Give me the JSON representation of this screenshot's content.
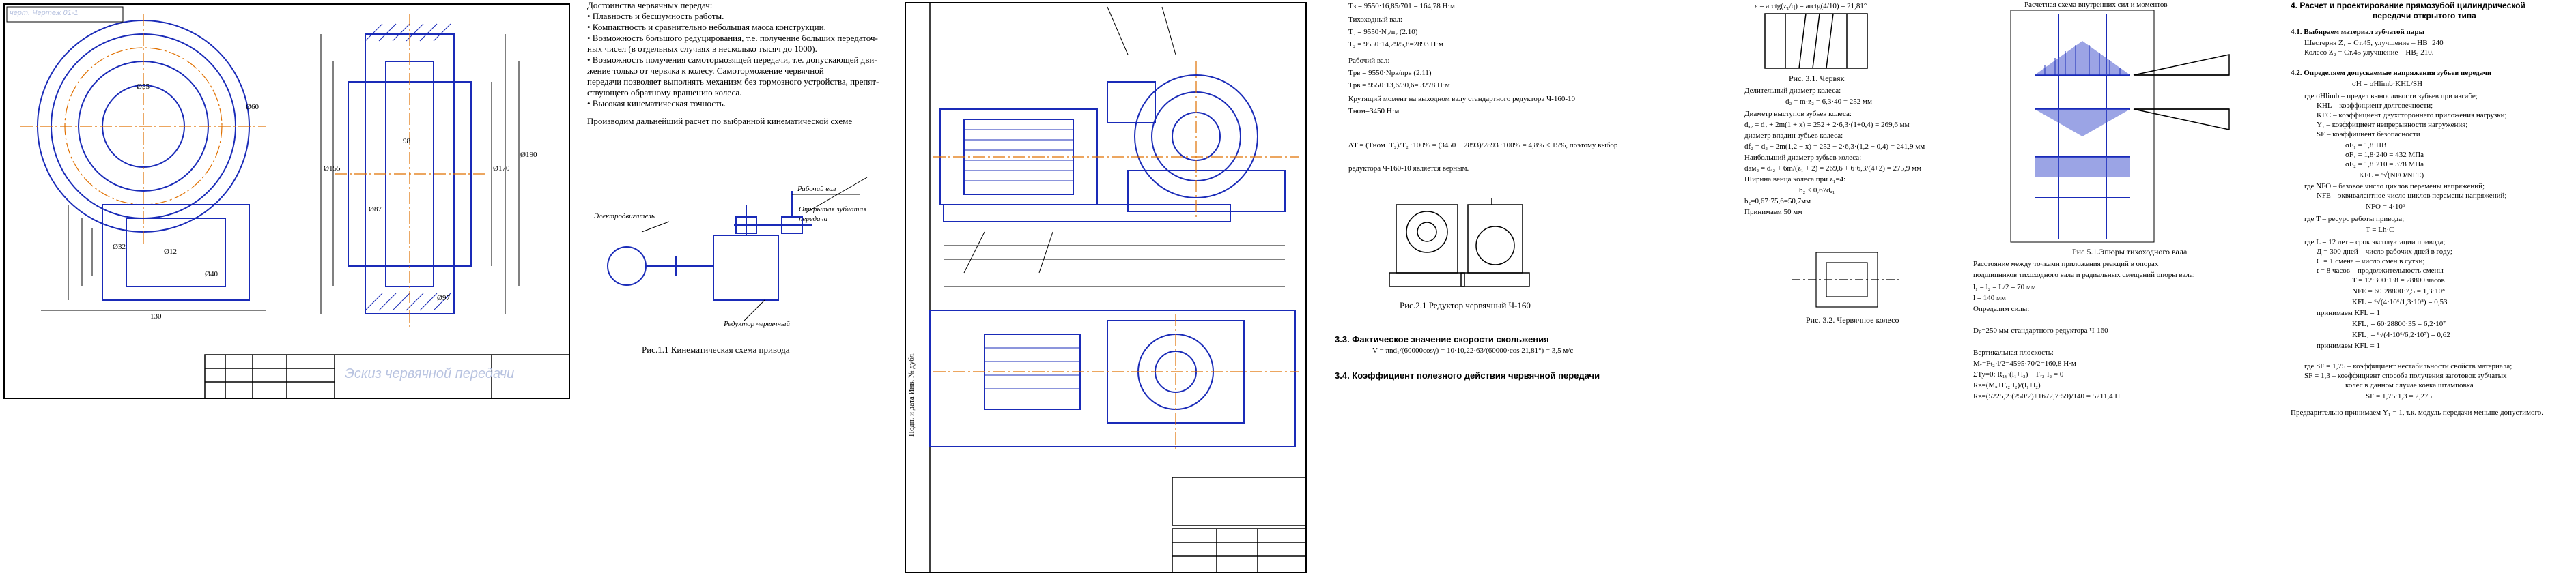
{
  "sheet1": {
    "corner_label": "черт. Чертеж  01-1",
    "title_block": "Эскиз червячной передачи",
    "dims": [
      "Ø55",
      "Ø60",
      "Ø32",
      "Ø12",
      "Ø40",
      "130",
      "Ø155",
      "Ø170",
      "Ø190",
      "98",
      "Ø87",
      "Ø97"
    ]
  },
  "sheet2": {
    "heading": "Достоинства червячных передач:",
    "bullets": [
      "• Плавность и бесшумность работы.",
      "• Компактность и сравнительно небольшая масса конструкции.",
      "• Возможность большого редуцирования, т.е. получение больших передаточ-",
      "  ных чисел (в отдельных случаях в несколько тысяч до 1000).",
      "• Возможность получения самотормозящей передачи, т.е. допускающей дви-",
      "  жение только от червяка к колесу. Самоторможение червячной",
      "  передачи позволяет выполнять механизм без тормозного устройства, препят-",
      "  ствующего обратному вращению колеса.",
      "• Высокая кинематическая точность."
    ],
    "paragraph": "Производим дальнейший расчет по выбранной кинематической схеме",
    "labels": [
      "Рабочий вал",
      "Открытая зубчатая",
      "передача",
      "Электродвигатель",
      "Редуктор червячный"
    ],
    "caption": "Рис.1.1 Кинематическая схема привода"
  },
  "sheet3": {
    "stamp": "Подп. и дата  Инв. № дубл."
  },
  "sheet4": {
    "lines": [
      "Тз = 9550·16,85/701 = 164,78 Н·м",
      "Тихоходный вал:",
      "Т₂ = 9550·N₂/n₂                                         (2.10)",
      "Т₂ = 9550·14,29/5,8=2893 Н·м",
      "Рабочий вал:",
      "Tрв = 9550·Nрв/nрв                                     (2.11)",
      "Tрв = 9550·13,6/30,6= 3278 Н·м",
      "Крутящий момент на выходном валу стандартного редуктора Ч-160-10",
      "Tном=3450 Н·м",
      "ΔT = (Tном−T₂)/T₂ ·100% = (3450 − 2893)/2893 ·100% = 4,8% < 15%, поэтому выбор",
      "редуктора Ч-160-10 является верным."
    ],
    "caption": "Рис.2.1 Редуктор червячный Ч-160",
    "section_33": "3.3.   Фактическое значение скорости скольжения",
    "line_33": "V = πnd₁/(60000cosγ) = 10·10,22·63/(60000·cos 21,81°) = 3,5 м/с",
    "section_34": "3.4.   Коэффициент полезного действия червячной передачи"
  },
  "sheet5": {
    "top": "ε = arctg(z₁/q) = arctg(4/10) = 21,81°",
    "caption_a": "Рис. 3.1. Червяк",
    "lines": [
      "Делительный диаметр колеса:",
      "d₂ = m·z₂ = 6,3·40 = 252 мм",
      "Диаметр выступов зубьев колеса:",
      "dₐ₂ = d₂ + 2m(1 + x) = 252 + 2·6,3·(1+0,4) = 269,6 мм",
      "диаметр впадин зубьев колеса:",
      "df₂ = d₂ − 2m(1,2 − x) = 252 − 2·6,3·(1,2 − 0,4) = 241,9 мм",
      "Наибольший диаметр зубьев колеса:",
      "daм₂ = dₐ₂ + 6m/(z₁ + 2) = 269,6 + 6·6,3/(4+2) = 275,9 мм",
      "Ширина венца колеса при z₁=4:",
      "b₂ ≤ 0,67dₐ₁",
      "b₂=0,67·75,6=50,7мм",
      "Принимаем 50 мм"
    ],
    "caption_b": "Рис. 3.2. Червячное колесо"
  },
  "sheet6": {
    "top": "Расчетная схема внутренних сил и моментов",
    "caption": "Рис 5.1.Эпюры тихоходного вала",
    "lines": [
      "Расстояние между точками приложения реакций в опорах",
      "подшипников тихоходного вала  и радиальных смещений опоры вала:",
      "l₁ = l₂ = L/2 = 70 мм",
      "l = 140 мм",
      "Определим силы:",
      "Dₚ=250 мм-стандартного редуктора Ч-160",
      "Вертикальная плоскость:",
      "Mₓ=Fₜ₂·l/2=4595·70/2=160,8 Н·м",
      "ΣTy=0: R₁ᵧ·(l₁+l₂) − Fᵣ₂·l₂ = 0",
      "Rв=(Mₓ+Fᵣ₂·l₂)/(l₁+l₂)",
      "Rв=(5225,2·(250/2)+1672,7·59)/140 = 5211,4 Н"
    ]
  },
  "sheet7": {
    "heading_a": "4. Расчет и проектирование прямозубой цилиндрической",
    "heading_b": "передачи открытого типа",
    "sub1": "4.1. Выбираем материал зубчатой пары",
    "mat1": "Шестерня Z₁ = Ст.45, улучшение – НВ₁ 240",
    "mat2": "Колесо Z₂ = Ст.45 улучшение – НВ₂ 210.",
    "sub2": "4.2.   Определяем допускаемые напряжения зубьев передачи",
    "lines": [
      "σH = σHlimb·KHL/SH",
      "где σHlimb – предел выносливости зубьев при изгибе;",
      "KHL – коэффициент долговечности;",
      "KFC – коэффициент двухстороннего приложения нагрузки;",
      "Y₁ – коэффициент непрерывности нагружения;",
      "SF – коэффициент безопасности",
      "σF₁ = 1,8·HB",
      "σF₁ = 1,8·240 = 432 МПа",
      "σF₂ = 1,8·210 = 378 МПа",
      "KFL = ⁶√(NFO/NFE)",
      "где NFO – базовое число циклов перемены напряжений;",
      "NFE – эквивалентное число циклов перемены напряжений;",
      "NFO = 4·10⁶",
      "где T – ресурс работы привода;",
      "T = Lh·C",
      "где L = 12 лет – срок эксплуатации привода;",
      "Д = 300 дней – число рабочих дней в году;",
      "C = 1 смена – число смен в сутки;",
      "t = 8 часов – продолжительность смены",
      "T = 12·300·1·8 = 28800 часов",
      "NFE = 60·28800·7,5 = 1,3·10⁸",
      "KFL = ⁶√(4·10⁶/1,3·10⁸) = 0,53",
      "принимаем KFL = 1",
      "KFL₁ = 60·28800·35 = 6,2·10⁷",
      "KFL₂ = ⁶√(4·10⁶/6,2·10⁷) = 0,62",
      "принимаем KFL = 1",
      "где SF = 1,75 – коэффициент нестабильности свойств материала;",
      "SF = 1,3 – коэффициент способа получения заготовок зубчатых",
      "колес в данном случае ковка штамповка",
      "SF = 1,75·1,3 = 2,275",
      "Предварительно принимаем Y₁ = 1, т.к. модуль передачи меньше допустимого."
    ]
  }
}
